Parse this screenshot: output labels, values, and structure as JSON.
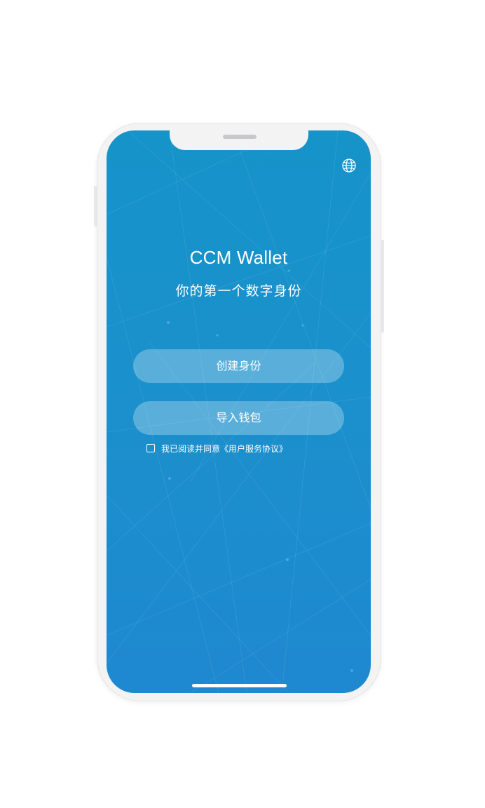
{
  "app": {
    "title": "CCM Wallet",
    "subtitle": "你的第一个数字身份"
  },
  "actions": {
    "create_identity": "创建身份",
    "import_wallet": "导入钱包"
  },
  "agreement": {
    "checked": false,
    "text": "我已阅读并同意",
    "link": "《用户服务协议》"
  },
  "icons": {
    "language": "globe-icon"
  },
  "colors": {
    "background_top": "#1693c9",
    "background_bottom": "#1e88d0",
    "button_fill": "rgba(255,255,255,0.28)",
    "text": "#ffffff"
  }
}
